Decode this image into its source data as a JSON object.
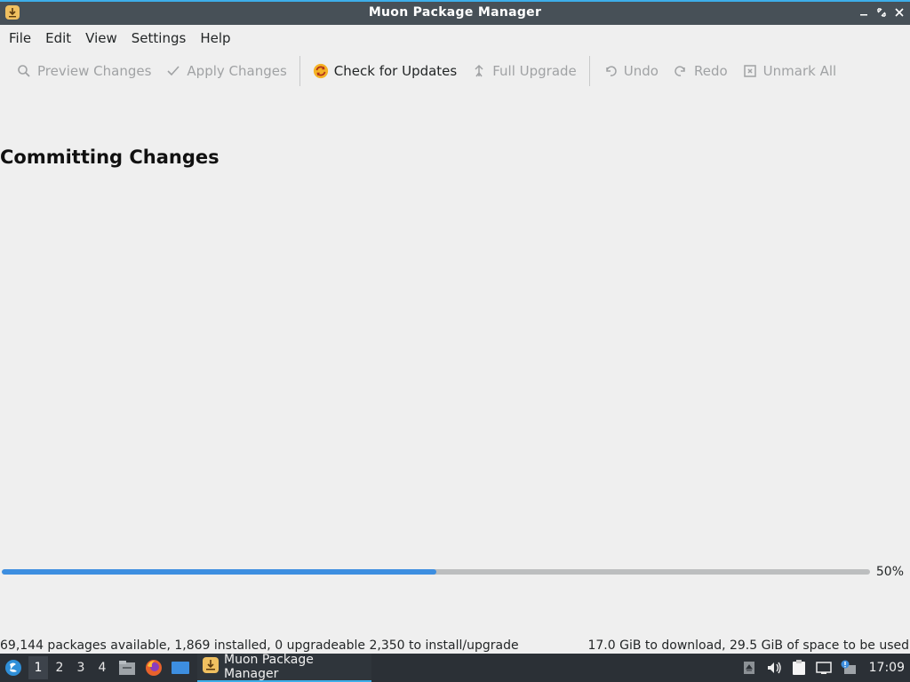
{
  "window": {
    "title": "Muon Package Manager",
    "icon": "muon-app-icon",
    "controls": [
      "minimize-icon",
      "maximize-icon",
      "close-icon"
    ]
  },
  "menubar": {
    "items": [
      "File",
      "Edit",
      "View",
      "Settings",
      "Help"
    ]
  },
  "toolbar": {
    "preview_changes": "Preview Changes",
    "apply_changes": "Apply Changes",
    "check_for_updates": "Check for Updates",
    "full_upgrade": "Full Upgrade",
    "undo": "Undo",
    "redo": "Redo",
    "unmark_all": "Unmark All"
  },
  "main": {
    "heading": "Committing Changes",
    "progress_value": 0.5,
    "progress_label": "50%"
  },
  "statusbar": {
    "left": "69,144 packages available, 1,869 installed, 0 upgradeable 2,350 to install/upgrade",
    "right": "17.0 GiB to download, 29.5 GiB of space to be used"
  },
  "taskbar": {
    "desktops": [
      "1",
      "2",
      "3",
      "4"
    ],
    "active_desktop": "1",
    "launchers": [
      "file-manager-icon",
      "firefox-icon",
      "desktop-icon"
    ],
    "task_label": "Muon Package Manager",
    "tray": [
      "removable-media-icon",
      "volume-icon",
      "clipboard-icon",
      "network-icon",
      "update-notifier-icon"
    ],
    "clock": "17:09"
  },
  "colors": {
    "accent": "#3d8ee0",
    "titlebar": "#475057",
    "taskbar": "#2b3036"
  }
}
